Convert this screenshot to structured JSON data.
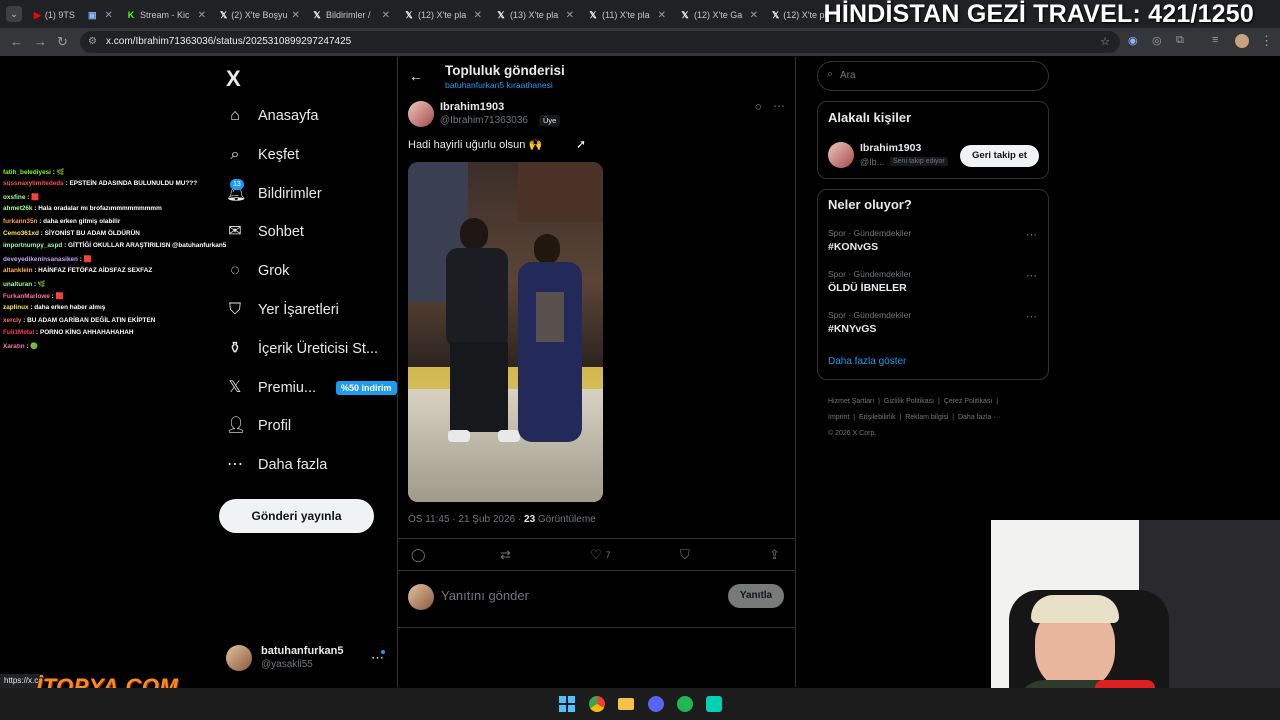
{
  "browser": {
    "tabs": [
      {
        "label": "(1) 9TS",
        "icon": "youtube-icon",
        "color": "#ff0000"
      },
      {
        "label": "",
        "icon": "window-icon",
        "color": "#8ab4f8"
      },
      {
        "label": "Stream - Kic",
        "icon": "kick-icon",
        "color": "#53fc18"
      },
      {
        "label": "(2) X'te Boşyu",
        "icon": "x-icon",
        "color": "#ffffff"
      },
      {
        "label": "Bildirimler /",
        "icon": "x-icon",
        "color": "#ffffff"
      },
      {
        "label": "(12) X'te pla",
        "icon": "x-icon",
        "color": "#ffffff"
      },
      {
        "label": "(13) X'te pla",
        "icon": "x-icon",
        "color": "#ffffff"
      },
      {
        "label": "(11) X'te pla",
        "icon": "x-icon",
        "color": "#ffffff"
      },
      {
        "label": "(12) X'te Ga",
        "icon": "x-icon",
        "color": "#ffffff"
      },
      {
        "label": "(12) X'te pla",
        "icon": "x-icon",
        "color": "#ffffff"
      }
    ],
    "url": "x.com/Ibrahim71363036/status/2025310899297247425",
    "status_link": "https://x.c"
  },
  "overlay": {
    "title": "HİNDİSTAN GEZİ TRAVEL: 421/1250",
    "watermark": "İTOPYA.COM"
  },
  "chat": [
    {
      "user": "fatih_belediyesi",
      "msg": "🌿",
      "color": "#7cfc00"
    },
    {
      "user": "sussnaxylimitededs",
      "msg": "EPSTEİN ADASINDA BULUNULDU MU???",
      "color": "#ff4d4d"
    },
    {
      "user": "oxsfine",
      "msg": "🟥",
      "color": "#9fff9f"
    },
    {
      "user": "ahmet26k",
      "msg": "Hala oradalar mı brofazımmmmmmmmm",
      "color": "#9fff9f"
    },
    {
      "user": "furkann35n",
      "msg": "daha erken gitmiş olabilir",
      "color": "#ff9f43"
    },
    {
      "user": "Cemo361xd",
      "msg": "SİYONİST BU ADAM ÖLDÜRÜN",
      "color": "#ffeb3b"
    },
    {
      "user": "importnumpy_aspd",
      "msg": "GİTTİĞİ OKULLAR ARAŞTIRILISN @batuhanfurkan5",
      "color": "#9fff9f"
    },
    {
      "user": "deveyedikeninsanasiken",
      "msg": "🟥",
      "color": "#c9a0ff"
    },
    {
      "user": "altanklein",
      "msg": "HAİNFAZ FETÖFAZ AİDSFAZ SEXFAZ",
      "color": "#ffb347"
    },
    {
      "user": "unalturan",
      "msg": "🌿",
      "color": "#9fff9f"
    },
    {
      "user": "FurkanMarlowe",
      "msg": "🟥",
      "color": "#ff6b9d"
    },
    {
      "user": "zaplinux",
      "msg": "daha erken haber almış",
      "color": "#ffeb3b"
    },
    {
      "user": "xercly",
      "msg": "BU ADAM GARİBAN DEĞİL ATIN EKİPTEN",
      "color": "#ff6b6b"
    },
    {
      "user": "Fuli1Metal",
      "msg": "PORNO KİNG AHHAHAHAHAH",
      "color": "#ff3355"
    },
    {
      "user": "Xaratın",
      "msg": "🟢",
      "color": "#ff77aa"
    }
  ],
  "sidebar": {
    "logo": "X",
    "items": [
      {
        "label": "Anasayfa",
        "icon": "home-icon",
        "glyph": "⌂"
      },
      {
        "label": "Keşfet",
        "icon": "search-icon",
        "glyph": "⌕"
      },
      {
        "label": "Bildirimler",
        "icon": "bell-icon",
        "glyph": "🔔︎",
        "badge": "13"
      },
      {
        "label": "Sohbet",
        "icon": "mail-icon",
        "glyph": "✉"
      },
      {
        "label": "Grok",
        "icon": "grok-icon",
        "glyph": "◌"
      },
      {
        "label": "Yer İşaretleri",
        "icon": "bookmark-icon",
        "glyph": "⛉"
      },
      {
        "label": "İçerik Üreticisi St...",
        "icon": "creator-icon",
        "glyph": "⚱"
      },
      {
        "label": "Premiu...",
        "icon": "x-premium-icon",
        "glyph": "𝕏",
        "badge": "%50 indirim"
      },
      {
        "label": "Profil",
        "icon": "profile-icon",
        "glyph": "👤︎"
      },
      {
        "label": "Daha fazla",
        "icon": "more-icon",
        "glyph": "⋯"
      }
    ],
    "post_button": "Gönderi yayınla",
    "account": {
      "name": "batuhanfurkan5",
      "handle": "@yasakli55"
    }
  },
  "post": {
    "header_title": "Topluluk gönderisi",
    "header_subtitle": "batuhanfurkan5 kıraathanesi",
    "author_name": "Ibrahim1903",
    "author_handle": "@Ibrahim71363036",
    "member_badge": "Üye",
    "text": "Hadi hayirli uğurlu olsun 🙌",
    "timestamp": "ÖS 11:45 · 21 Şub 2026 · ",
    "views": "23",
    "views_label": " Görüntüleme",
    "likes": "7",
    "reply_placeholder": "Yanıtını gönder",
    "reply_button": "Yanıtla"
  },
  "right": {
    "search_placeholder": "Ara",
    "relevant_title": "Alakalı kişiler",
    "person": {
      "name": "Ibrahim1903",
      "handle": "@Ib...",
      "follows_you": "Seni takip ediyor",
      "follow_back": "Geri takip et"
    },
    "trends_title": "Neler oluyor?",
    "trends": [
      {
        "meta": "Spor · Gündemdekiler",
        "name": "#KONvGS"
      },
      {
        "meta": "Spor · Gündemdekiler",
        "name": "ÖLDÜ İBNELER"
      },
      {
        "meta": "Spor · Gündemdekiler",
        "name": "#KNYvGS"
      }
    ],
    "show_more": "Daha fazla göster",
    "footer": [
      "Hizmet Şartları",
      "Gizlilik Politikası",
      "Çerez Politikası",
      "Imprint",
      "Erişilebilirlik",
      "Reklam bilgisi",
      "Daha fazla ···",
      "© 2026 X Corp."
    ]
  },
  "colors": {
    "accent": "#1d9bf0",
    "border": "#2f3336",
    "muted": "#71767b"
  }
}
